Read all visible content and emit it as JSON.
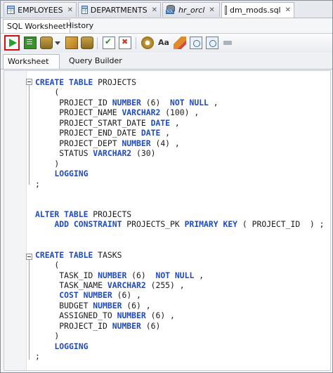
{
  "file_tabs": [
    {
      "label": "EMPLOYEES",
      "icon": "table-icon"
    },
    {
      "label": "DEPARTMENTS",
      "icon": "table-icon"
    },
    {
      "label": "hr_orcl",
      "icon": "sql-connection-icon"
    },
    {
      "label": "dm_mods.sql",
      "icon": "sql-file-icon"
    }
  ],
  "sub_tabs": [
    "SQL Worksheet",
    "History"
  ],
  "worksheet_tabs": [
    "Worksheet",
    "Query Builder"
  ],
  "toolbar_icons": [
    "run-statement-icon",
    "run-script-icon",
    "autotrace-icon",
    "dropdown-caret-icon",
    "explain-icon",
    "commit-icon",
    "rollback-icon",
    "tuning-advisor-icon",
    "format-icon",
    "clear-icon",
    "sql-history-icon",
    "explain-plan-icon"
  ],
  "code_lines": [
    [
      {
        "t": "CREATE TABLE",
        "k": true
      },
      {
        "t": " PROJECTS"
      }
    ],
    [
      {
        "t": "    ("
      }
    ],
    [
      {
        "t": "     PROJECT_ID "
      },
      {
        "t": "NUMBER",
        "k": true
      },
      {
        "t": " (6)  "
      },
      {
        "t": "NOT NULL",
        "k": true
      },
      {
        "t": " ,"
      }
    ],
    [
      {
        "t": "     PROJECT_NAME "
      },
      {
        "t": "VARCHAR2",
        "k": true
      },
      {
        "t": " (100) ,"
      }
    ],
    [
      {
        "t": "     PROJECT_START_DATE "
      },
      {
        "t": "DATE",
        "k": true
      },
      {
        "t": " ,"
      }
    ],
    [
      {
        "t": "     PROJECT_END_DATE "
      },
      {
        "t": "DATE",
        "k": true
      },
      {
        "t": " ,"
      }
    ],
    [
      {
        "t": "     PROJECT_DEPT "
      },
      {
        "t": "NUMBER",
        "k": true
      },
      {
        "t": " (4) ,"
      }
    ],
    [
      {
        "t": "     STATUS "
      },
      {
        "t": "VARCHAR2",
        "k": true
      },
      {
        "t": " (30)"
      }
    ],
    [
      {
        "t": "    )"
      }
    ],
    [
      {
        "t": "    "
      },
      {
        "t": "LOGGING",
        "k": true
      }
    ],
    [
      {
        "t": ";"
      }
    ],
    [
      {
        "t": ""
      }
    ],
    [
      {
        "t": ""
      }
    ],
    [
      {
        "t": "ALTER TABLE",
        "k": true
      },
      {
        "t": " PROJECTS"
      }
    ],
    [
      {
        "t": "    "
      },
      {
        "t": "ADD CONSTRAINT",
        "k": true
      },
      {
        "t": " PROJECTS_PK "
      },
      {
        "t": "PRIMARY KEY",
        "k": true
      },
      {
        "t": " ( PROJECT_ID  ) ;"
      }
    ],
    [
      {
        "t": ""
      }
    ],
    [
      {
        "t": ""
      }
    ],
    [
      {
        "t": "CREATE TABLE",
        "k": true
      },
      {
        "t": " TASKS"
      }
    ],
    [
      {
        "t": "    ("
      }
    ],
    [
      {
        "t": "     TASK_ID "
      },
      {
        "t": "NUMBER",
        "k": true
      },
      {
        "t": " (6)  "
      },
      {
        "t": "NOT NULL",
        "k": true
      },
      {
        "t": " ,"
      }
    ],
    [
      {
        "t": "     TASK_NAME "
      },
      {
        "t": "VARCHAR2",
        "k": true
      },
      {
        "t": " (255) ,"
      }
    ],
    [
      {
        "t": "     "
      },
      {
        "t": "COST",
        "k": true
      },
      {
        "t": " "
      },
      {
        "t": "NUMBER",
        "k": true
      },
      {
        "t": " (6) ,"
      }
    ],
    [
      {
        "t": "     BUDGET "
      },
      {
        "t": "NUMBER",
        "k": true
      },
      {
        "t": " (6) ,"
      }
    ],
    [
      {
        "t": "     ASSIGNED_TO "
      },
      {
        "t": "NUMBER",
        "k": true
      },
      {
        "t": " (6) ,"
      }
    ],
    [
      {
        "t": "     PROJECT_ID "
      },
      {
        "t": "NUMBER",
        "k": true
      },
      {
        "t": " (6)"
      }
    ],
    [
      {
        "t": "    )"
      }
    ],
    [
      {
        "t": "    "
      },
      {
        "t": "LOGGING",
        "k": true
      }
    ],
    [
      {
        "t": ";"
      }
    ]
  ]
}
